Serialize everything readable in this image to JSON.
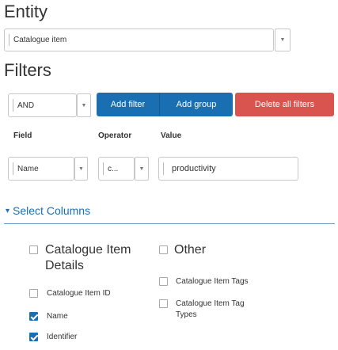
{
  "entity": {
    "heading": "Entity",
    "selected": "Catalogue item"
  },
  "filters": {
    "heading": "Filters",
    "logic_selected": "AND",
    "add_filter_label": "Add filter",
    "add_group_label": "Add group",
    "delete_all_label": "Delete all filters",
    "col_field": "Field",
    "col_operator": "Operator",
    "col_value": "Value",
    "row": {
      "field": "Name",
      "operator": "c...",
      "value": "productivity"
    }
  },
  "columns": {
    "toggle_label": "Select Columns",
    "groups": [
      {
        "title_line1": "Catalogue Item",
        "title_line2": "Details",
        "items": [
          {
            "label": "Catalogue Item ID",
            "checked": false
          },
          {
            "label": "Name",
            "checked": true
          },
          {
            "label": "Identifier",
            "checked": true
          }
        ]
      },
      {
        "title": "Other",
        "items": [
          {
            "label": "Catalogue Item Tags",
            "checked": false
          },
          {
            "label_line1": "Catalogue Item Tag",
            "label_line2": "Types",
            "checked": false
          }
        ]
      }
    ]
  },
  "colors": {
    "primary": "#1a6fb3",
    "danger": "#d9534f",
    "check": "#1a6fb3"
  },
  "icons": {
    "dropdown": "chevron-down-icon",
    "section_toggle": "chevron-down-icon"
  }
}
